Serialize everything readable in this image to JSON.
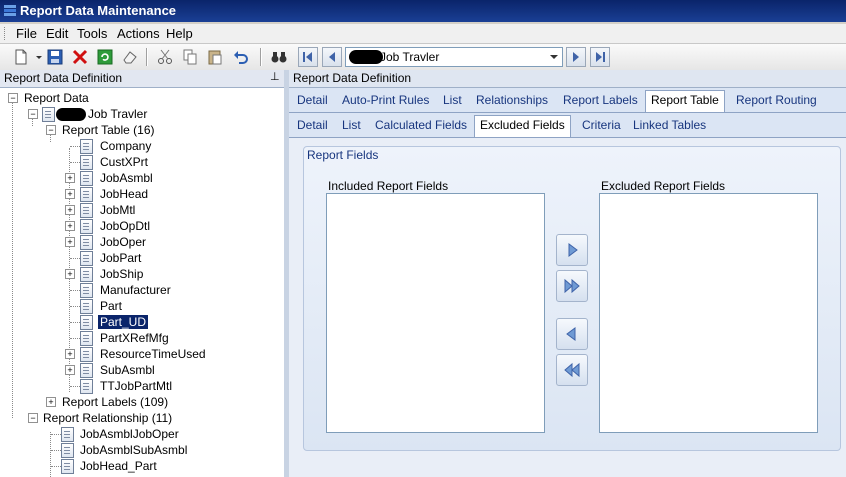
{
  "window": {
    "title": "Report Data Maintenance"
  },
  "menu": [
    {
      "label": "File"
    },
    {
      "label": "Edit"
    },
    {
      "label": "Tools"
    },
    {
      "label": "Actions"
    },
    {
      "label": "Help"
    }
  ],
  "toolbar": {
    "record_combo_value": "Job Travler"
  },
  "left_panel": {
    "header": "Report Data Definition",
    "tree": {
      "root": "Report Data",
      "report_name": "Job Travler",
      "report_table": "Report Table (16)",
      "tables": [
        "Company",
        "CustXPrt",
        "JobAsmbl",
        "JobHead",
        "JobMtl",
        "JobOpDtl",
        "JobOper",
        "JobPart",
        "JobShip",
        "Manufacturer",
        "Part",
        "Part_UD",
        "PartXRefMfg",
        "ResourceTimeUsed",
        "SubAsmbl",
        "TTJobPartMtl"
      ],
      "selected_table": "Part_UD",
      "report_labels": "Report Labels (109)",
      "report_relationship": "Report Relationship (11)",
      "relationships": [
        "JobAsmblJobOper",
        "JobAsmblSubAsmbl",
        "JobHead_Part"
      ]
    }
  },
  "right_panel": {
    "header": "Report Data Definition",
    "tabs_top": [
      {
        "label": "Detail"
      },
      {
        "label": "Auto-Print Rules"
      },
      {
        "label": "List"
      },
      {
        "label": "Relationships"
      },
      {
        "label": "Report Labels"
      },
      {
        "label": "Report Table"
      },
      {
        "label": "Report Routing"
      }
    ],
    "tabs_top_active": "Report Table",
    "tabs_sub": [
      {
        "label": "Detail"
      },
      {
        "label": "List"
      },
      {
        "label": "Calculated Fields"
      },
      {
        "label": "Excluded Fields"
      },
      {
        "label": "Criteria"
      },
      {
        "label": "Linked Tables"
      }
    ],
    "tabs_sub_active": "Excluded Fields",
    "group_title": "Report Fields",
    "included_label": "Included Report Fields",
    "excluded_label": "Excluded Report Fields"
  },
  "colors": {
    "title_bar": "#0a246a",
    "selection": "#0a246a",
    "tab_text": "#17357e"
  },
  "icons": [
    "app-icon",
    "new-icon",
    "dropdown-arrow-icon",
    "save-icon",
    "delete-icon",
    "refresh-icon",
    "eraser-icon",
    "cut-icon",
    "copy-icon",
    "paste-icon",
    "undo-icon",
    "binoculars-icon",
    "first-record-icon",
    "prev-record-icon",
    "next-record-icon",
    "last-record-icon",
    "pin-icon",
    "move-right-icon",
    "move-all-right-icon",
    "move-left-icon",
    "move-all-left-icon"
  ]
}
